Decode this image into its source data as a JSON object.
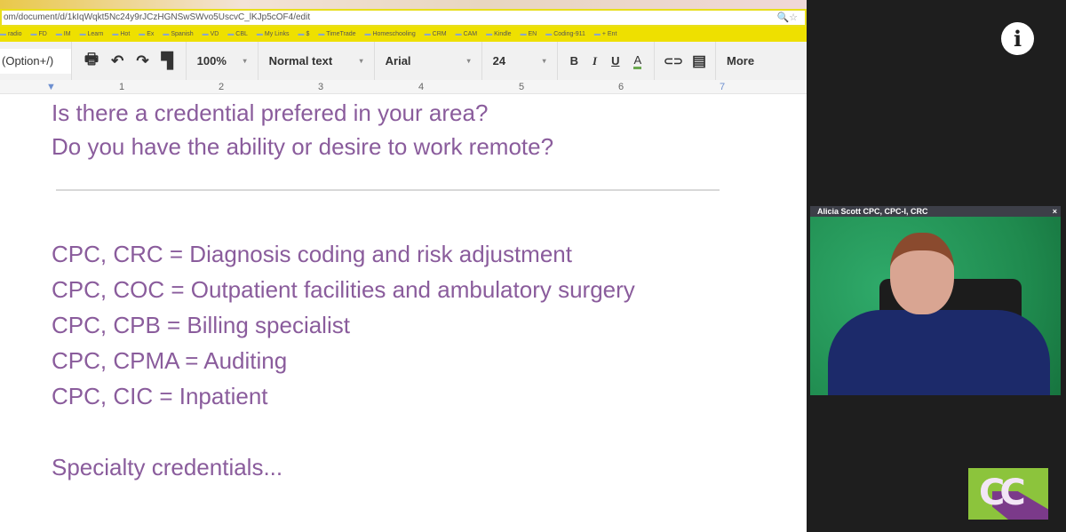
{
  "browser": {
    "url": "om/document/d/1kIqWqkt5Nc24y9rJCzHGNSwSWvo5UscvC_lKJp5cOF4/edit",
    "bookmarks": [
      "radio",
      "FD",
      "IM",
      "Learn",
      "Hot",
      "Ex",
      "Spanish",
      "VD",
      "CBL",
      "My Links",
      "$",
      "TimeTrade",
      "Homeschooling",
      "CRM",
      "CAM",
      "Kindle",
      "EN",
      "Coding-911",
      "+ Ent"
    ]
  },
  "toolbar": {
    "shortcut_hint": "(Option+/)",
    "zoom": "100%",
    "style": "Normal text",
    "font": "Arial",
    "size": "24",
    "bold": "B",
    "italic": "I",
    "underline": "U",
    "text_color": "A",
    "more": "More",
    "text_color_bar": "#6aa84f"
  },
  "ruler": [
    "1",
    "2",
    "3",
    "4",
    "5",
    "6",
    "7"
  ],
  "document": {
    "questions": [
      "Is there a credential prefered in your area?",
      "Do you have the ability or desire to work remote?"
    ],
    "credentials": [
      "CPC, CRC = Diagnosis coding and risk adjustment",
      "CPC, COC = Outpatient facilities and ambulatory surgery",
      "CPC, CPB = Billing specialist",
      "CPC, CPMA = Auditing",
      "CPC, CIC = Inpatient"
    ],
    "footer": "Specialty credentials...",
    "text_color": "#8a5c9c"
  },
  "video": {
    "presenter": "Alicia Scott CPC, CPC-I, CRC",
    "close": "×"
  },
  "info_icon": "i",
  "logo": {
    "text": "CCo",
    "colors": [
      "#8cc43c",
      "#7b3a8a"
    ]
  }
}
